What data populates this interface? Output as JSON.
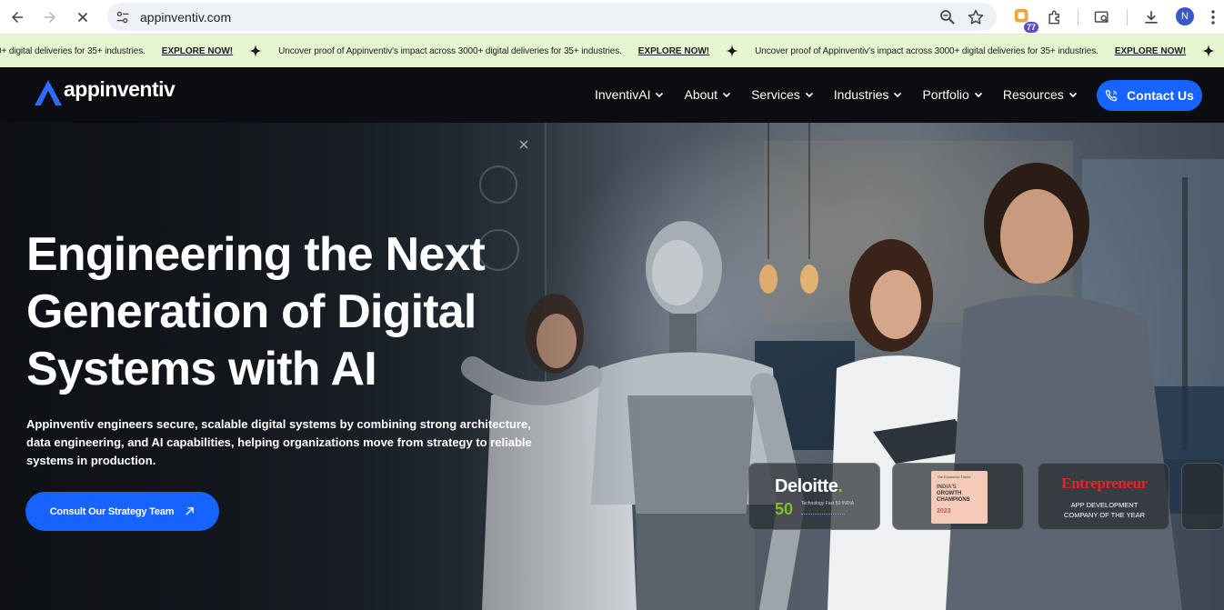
{
  "browser": {
    "url": "appinventiv.com",
    "extension_badge": "77",
    "profile_initial": "N"
  },
  "ticker": {
    "first_fragment": "0+ digital deliveries for 35+ industries.",
    "message": "Uncover proof of Appinventiv's impact across 3000+ digital deliveries for 35+ industries.",
    "link": "EXPLORE NOW!"
  },
  "header": {
    "logo_text": "appinventiv",
    "menu": [
      {
        "label": "InventivAI"
      },
      {
        "label": "About"
      },
      {
        "label": "Services"
      },
      {
        "label": "Industries"
      },
      {
        "label": "Portfolio"
      },
      {
        "label": "Resources"
      }
    ],
    "contact_label": "Contact Us"
  },
  "hero": {
    "title_line1": "Engineering the Next",
    "title_line2": "Generation of Digital",
    "title_line3": "Systems with AI",
    "subtitle": "Appinventiv engineers secure, scalable digital systems by combining strong architecture, data engineering, and AI capabilities, helping organizations move from strategy to reliable systems in production.",
    "cta_label": "Consult Our Strategy Team"
  },
  "awards": {
    "deloitte": {
      "name": "Deloitte",
      "dot": ".",
      "number": "50",
      "small": "Technology Fast 50 INDIA"
    },
    "et": {
      "top": "The Economic Times",
      "line1": "INDIA'S",
      "line2": "GROWTH",
      "line3": "CHAMPIONS",
      "year": "2023"
    },
    "entrepreneur": {
      "name": "Entrepreneur",
      "line1": "APP DEVELOPMENT",
      "line2": "COMPANY OF THE YEAR"
    }
  },
  "colors": {
    "accent": "#1663ff",
    "ticker_bg": "#e6f6d0",
    "header_bg": "#0c0d10",
    "deloitte_green": "#86bc25",
    "entrepreneur_red": "#e8242a"
  }
}
